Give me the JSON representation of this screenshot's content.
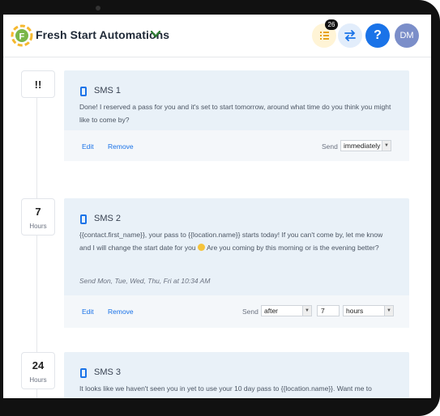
{
  "app": {
    "brand": "Fresh Start Automations"
  },
  "topbar": {
    "badge_count": "26",
    "help_label": "?",
    "avatar_initials": "DM"
  },
  "steps": [
    {
      "delay_value": "!!",
      "delay_unit": ""
    },
    {
      "delay_value": "7",
      "delay_unit": "Hours"
    },
    {
      "delay_value": "24",
      "delay_unit": "Hours"
    }
  ],
  "messages": [
    {
      "title": "SMS 1",
      "body": "Done! I reserved a pass for you and it's set to start tomorrow, around what time do you think you might like to come by?",
      "edit_label": "Edit",
      "remove_label": "Remove",
      "send_label": "Send",
      "send_mode": "immediately"
    },
    {
      "title": "SMS 2",
      "body_part1": "{{contact.first_name}}, your pass to {{location.name}} starts today! If you can't come by, let me know and I will change the start date for you",
      "body_part2": "Are you coming by this morning or is the evening better?",
      "schedule": "Send Mon, Tue, Wed, Thu, Fri at 10:34 AM",
      "edit_label": "Edit",
      "remove_label": "Remove",
      "send_label": "Send",
      "send_mode": "after",
      "send_amount": "7",
      "send_unit": "hours"
    },
    {
      "title": "SMS 3",
      "body": "It looks like we haven't seen you in yet to use your 10 day pass to {{location.name}}. Want me to"
    }
  ],
  "colors": {
    "accent": "#1a73e8",
    "card_bg": "#e9f1f8",
    "help_bg": "#1a73e8",
    "avatar_bg": "#7b8ec9"
  }
}
